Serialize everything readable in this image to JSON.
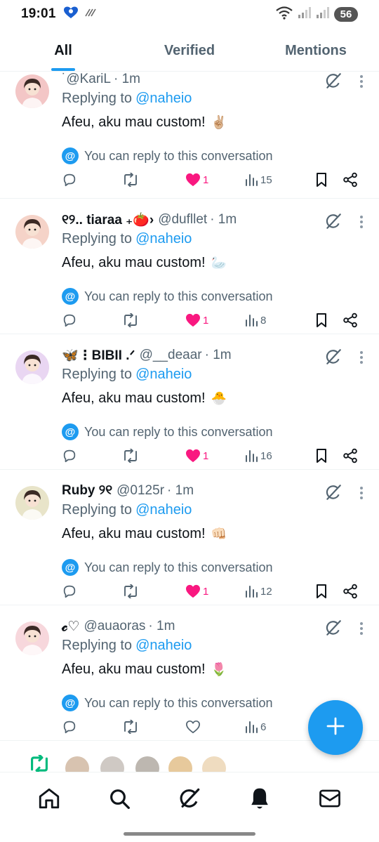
{
  "status_bar": {
    "time": "19:01",
    "battery": "56"
  },
  "tabs": [
    {
      "label": "All",
      "active": true
    },
    {
      "label": "Verified",
      "active": false
    },
    {
      "label": "Mentions",
      "active": false
    }
  ],
  "posts": [
    {
      "display_name": "",
      "handle": "˙@KariL",
      "time": "· 1m",
      "replying_prefix": "Replying to",
      "replying_to": "@naheio",
      "text": "Afeu, aku mau custom!",
      "emoji": "✌🏼",
      "conversation_note": "You can reply to this conversation",
      "liked": true,
      "likes": "1",
      "views": "15",
      "avatar_color": "#f3c6c6"
    },
    {
      "display_name": "୧୨.. tiaraa ₊🍅›",
      "handle": "@dufllet",
      "time": "· 1m",
      "replying_prefix": "Replying to",
      "replying_to": "@naheio",
      "text": "Afeu, aku mau custom!",
      "emoji": "🦢",
      "conversation_note": "You can reply to this conversation",
      "liked": true,
      "likes": "1",
      "views": "8",
      "avatar_color": "#f5d3c8"
    },
    {
      "display_name": "🦋⋮BIBII .ᐟ",
      "handle": "@__deaar",
      "time": "· 1m",
      "replying_prefix": "Replying to",
      "replying_to": "@naheio",
      "text": "Afeu, aku mau custom!",
      "emoji": "🐣",
      "conversation_note": "You can reply to this conversation",
      "liked": true,
      "likes": "1",
      "views": "16",
      "avatar_color": "#e9d6f2"
    },
    {
      "display_name": "Ruby ୨୧",
      "handle": "@0125r",
      "time": "· 1m",
      "replying_prefix": "Replying to",
      "replying_to": "@naheio",
      "text": "Afeu, aku mau custom!",
      "emoji": "👊🏻",
      "conversation_note": "You can reply to this conversation",
      "liked": true,
      "likes": "1",
      "views": "12",
      "avatar_color": "#e8e4c9"
    },
    {
      "display_name": "𝓬♡",
      "handle": "@auaoras",
      "time": "· 1m",
      "replying_prefix": "Replying to",
      "replying_to": "@naheio",
      "text": "Afeu, aku mau custom!",
      "emoji": "🌷",
      "conversation_note": "You can reply to this conversation",
      "liked": false,
      "likes": "",
      "views": "6",
      "avatar_color": "#f7d7dc"
    }
  ],
  "strip_avatar_colors": [
    "#d8c3b0",
    "#cfc9c4",
    "#bdb7b0",
    "#e7c99c",
    "#efdcc0"
  ],
  "colors": {
    "accent": "#1d9bf0",
    "like": "#f91880",
    "retweet_green": "#00ba7c",
    "muted": "#536471"
  },
  "bottom_nav": [
    {
      "icon": "home-icon"
    },
    {
      "icon": "search-icon"
    },
    {
      "icon": "grok-icon"
    },
    {
      "icon": "notifications-icon"
    },
    {
      "icon": "messages-icon"
    }
  ]
}
